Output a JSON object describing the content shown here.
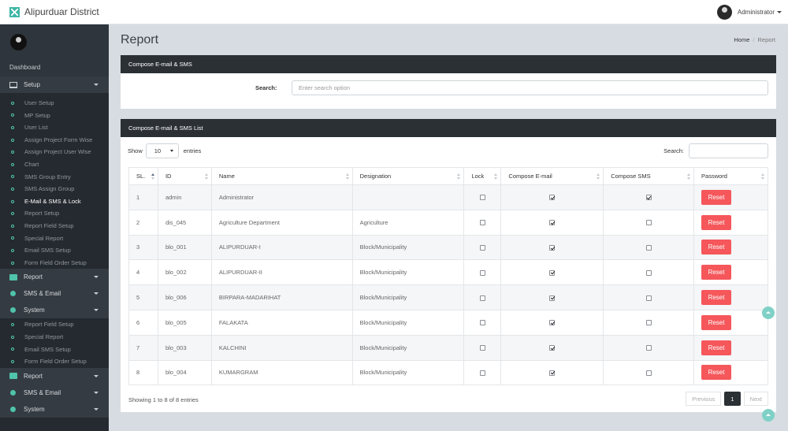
{
  "app": {
    "title": "Alipurduar District"
  },
  "user": {
    "name": "Administrator"
  },
  "sidebar": {
    "dashboard": "Dashboard",
    "groups": {
      "setup": "Setup",
      "report": "Report",
      "sms_email": "SMS & Email",
      "system": "System"
    },
    "setup_items": [
      "User Setup",
      "MP Setup",
      "User List",
      "Assign Project Form Wise",
      "Assign Project User Wise",
      "Chart",
      "SMS Group Entry",
      "SMS Assign Group",
      "E-Mail & SMS & Lock",
      "Report Setup",
      "Report Field Setup",
      "Special Report",
      "Email SMS Setup",
      "Form Field Order Setup"
    ],
    "system_items": [
      "Report Field Setup",
      "Special Report",
      "Email SMS Setup",
      "Form Field Order Setup"
    ],
    "lower_groups": {
      "report": "Report",
      "sms_email": "SMS & Email",
      "system": "System"
    }
  },
  "page": {
    "title": "Report",
    "breadcrumb_home": "Home",
    "breadcrumb_sep": "/",
    "breadcrumb_current": "Report"
  },
  "compose": {
    "heading": "Compose E-mail & SMS",
    "search_label": "Search:",
    "search_placeholder": "Enter search option"
  },
  "list": {
    "heading": "Compose E-mail & SMS List",
    "show_label": "Show",
    "entries_value": "10",
    "entries_label": "entries",
    "search_label": "Search:",
    "columns": [
      "SL.",
      "ID",
      "Name",
      "Designation",
      "Lock",
      "Compose E-mail",
      "Compose SMS",
      "Password"
    ],
    "reset_label": "Reset",
    "rows": [
      {
        "sl": "1",
        "id": "admin",
        "name": "Administrator",
        "designation": "",
        "lock": false,
        "email": true,
        "sms": true
      },
      {
        "sl": "2",
        "id": "dis_045",
        "name": "Agriculture Department",
        "designation": "Agriculture",
        "lock": false,
        "email": true,
        "sms": false
      },
      {
        "sl": "3",
        "id": "blo_001",
        "name": "ALIPURDUAR-I",
        "designation": "Block/Municipality",
        "lock": false,
        "email": true,
        "sms": false
      },
      {
        "sl": "4",
        "id": "blo_002",
        "name": "ALIPURDUAR-II",
        "designation": "Block/Municipality",
        "lock": false,
        "email": true,
        "sms": false
      },
      {
        "sl": "5",
        "id": "blo_006",
        "name": "BIRPARA-MADARIHAT",
        "designation": "Block/Municipality",
        "lock": false,
        "email": true,
        "sms": false
      },
      {
        "sl": "6",
        "id": "blo_005",
        "name": "FALAKATA",
        "designation": "Block/Municipality",
        "lock": false,
        "email": true,
        "sms": false
      },
      {
        "sl": "7",
        "id": "blo_003",
        "name": "KALCHINI",
        "designation": "Block/Municipality",
        "lock": false,
        "email": true,
        "sms": false
      },
      {
        "sl": "8",
        "id": "blo_004",
        "name": "KUMARGRAM",
        "designation": "Block/Municipality",
        "lock": false,
        "email": true,
        "sms": false
      }
    ],
    "info": "Showing 1 to 8 of 8 entries",
    "pager": {
      "previous": "Previous",
      "current": "1",
      "next": "Next"
    }
  }
}
